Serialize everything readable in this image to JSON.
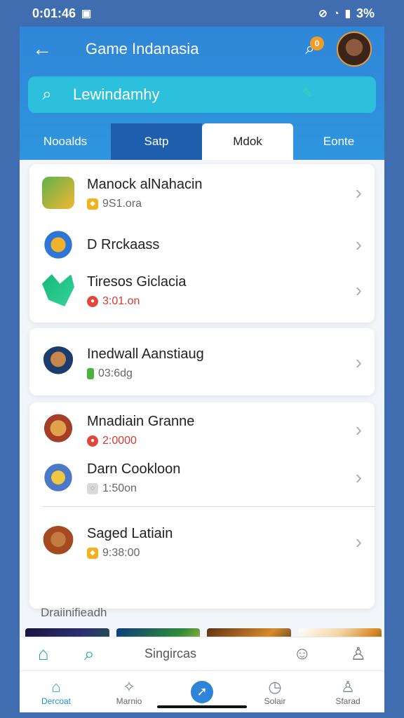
{
  "status": {
    "time": "0:01:46",
    "battery": "3%"
  },
  "header": {
    "title": "Game Indanasia",
    "notification_count": "0"
  },
  "search": {
    "value": "Lewindamhy"
  },
  "tabs": [
    {
      "label": "Nooalds"
    },
    {
      "label": "Satp"
    },
    {
      "label": "Mdok"
    },
    {
      "label": "Eonte"
    }
  ],
  "lists": {
    "group1": [
      {
        "title": "Manock alNahacin",
        "meta": "9S1.ora",
        "icon": "gold-badge-icon"
      },
      {
        "title": "D Rrckaass",
        "meta": "",
        "icon": ""
      },
      {
        "title": "Tiresos Giclacia",
        "meta": "3:01.on",
        "icon": "red-badge-icon"
      }
    ],
    "group2": [
      {
        "title": "Inedwall Aanstiaug",
        "meta": "03:6dg",
        "icon": "green-badge-icon"
      }
    ],
    "group3": [
      {
        "title": "Mnadiain Granne",
        "meta": "2:0000",
        "icon": "red-badge-icon"
      },
      {
        "title": "Darn Cookloon",
        "meta": "1:50on",
        "icon": "gray-badge-icon"
      },
      {
        "title": "Saged Latiain",
        "meta": "9:38:00",
        "icon": "gold-badge-icon"
      }
    ]
  },
  "section": {
    "label": "Draiinifieadh"
  },
  "bottom_search": {
    "label": "Singircas"
  },
  "nav": [
    {
      "label": "Dercoat",
      "icon": "home-icon"
    },
    {
      "label": "Marnio",
      "icon": "puzzle-icon"
    },
    {
      "label": "",
      "icon": "compass-icon"
    },
    {
      "label": "Solair",
      "icon": "badge-icon"
    },
    {
      "label": "Sfarad",
      "icon": "person-icon"
    }
  ],
  "colors": {
    "primary": "#2f86d7",
    "accent": "#2dc0dc",
    "nav_active": "#248fd8"
  }
}
